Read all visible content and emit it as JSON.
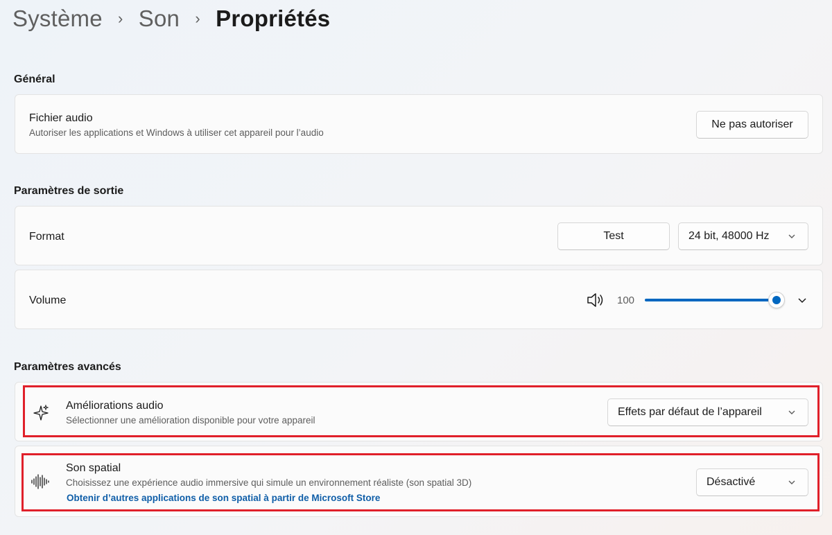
{
  "breadcrumb": {
    "item1": "Système",
    "item2": "Son",
    "current": "Propriétés",
    "separator": "›"
  },
  "sections": {
    "general": "Général",
    "output": "Paramètres de sortie",
    "advanced": "Paramètres avancés"
  },
  "audio_file": {
    "title": "Fichier audio",
    "description": "Autoriser les applications et Windows à utiliser cet appareil pour l’audio",
    "button": "Ne pas autoriser"
  },
  "format": {
    "title": "Format",
    "test_button": "Test",
    "selected": "24 bit, 48000 Hz"
  },
  "volume": {
    "title": "Volume",
    "value": "100",
    "level_percent": 100,
    "icon": "speaker-icon"
  },
  "enhancements": {
    "title": "Améliorations audio",
    "description": "Sélectionner une amélioration disponible pour votre appareil",
    "selected": "Effets par défaut de l’appareil",
    "icon": "sparkle-icon"
  },
  "spatial": {
    "title": "Son spatial",
    "description": "Choisissez une expérience audio immersive qui simule un environnement réaliste (son spatial 3D)",
    "link": "Obtenir d’autres applications de son spatial à partir de Microsoft Store",
    "selected": "Désactivé",
    "icon": "waveform-icon"
  },
  "colors": {
    "accent": "#0067c0",
    "highlight": "#e0202a",
    "link": "#0f5ea8"
  }
}
